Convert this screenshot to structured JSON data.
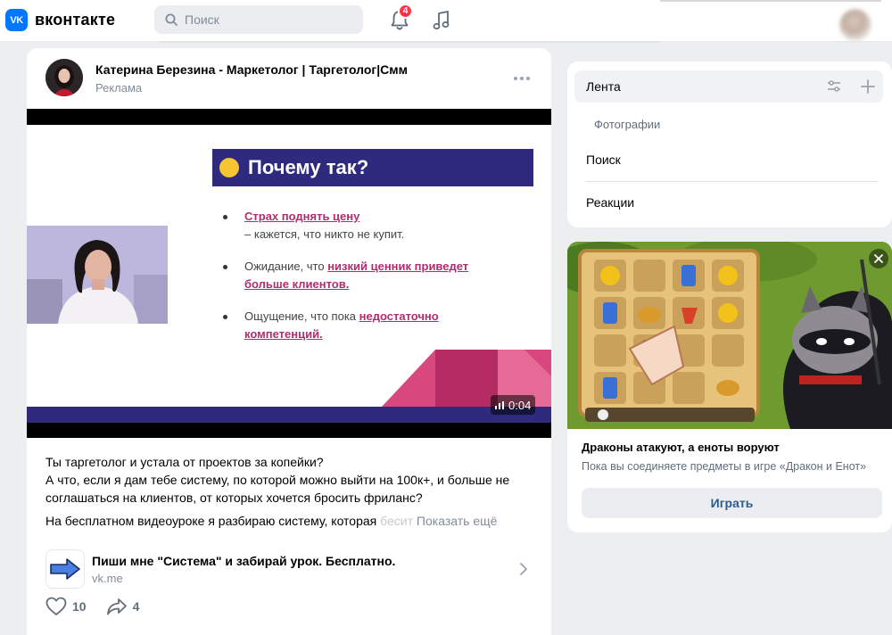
{
  "header": {
    "logo_mark": "VK",
    "logo_text": "вконтакте",
    "search_placeholder": "Поиск",
    "notifications_count": "4"
  },
  "post": {
    "author": "Катерина Березина - Маркетолог | Таргетолог|Смм",
    "subtitle": "Реклама",
    "video": {
      "slide_title": "Почему так?",
      "bullet1_highlight": "Страх поднять цену",
      "bullet1_rest": "– кажется, что никто не купит.",
      "bullet2_text": "Ожидание, что ",
      "bullet2_highlight": "низкий ценник приведет больше клиентов.",
      "bullet3_text": "Ощущение, что пока ",
      "bullet3_highlight": "недостаточно компетенций.",
      "duration": "0:04"
    },
    "text_p1_line1": "Ты таргетолог и устала от проектов за копейки?",
    "text_p1_line2": "А что, если я дам тебе систему, по которой можно выйти на 100к+, и больше не соглашаться на клиентов, от которых хочется бросить фриланс?",
    "text_p2": "На бесплатном видеоуроке я разбираю систему, которая бесит",
    "text_p2_fade": " бесит",
    "show_more": "Показать ещё",
    "link_title": "Пиши мне \"Система\" и забирай урок. Бесплатно.",
    "link_domain": "vk.me",
    "likes": "10",
    "shares": "4"
  },
  "menu": {
    "items": [
      {
        "label": "Лента"
      },
      {
        "label": "Фотографии"
      },
      {
        "label": "Поиск"
      },
      {
        "label": "Реакции"
      }
    ]
  },
  "ad": {
    "title": "Драконы атакуют, а еноты воруют",
    "description": "Пока вы соединяете предметы в игре «Дракон и Енот»",
    "button_label": "Играть"
  },
  "colors": {
    "accent": "#0077ff",
    "badge": "#ff3347",
    "slide_title_bg": "#2e2a7e",
    "highlight": "#b02e6e"
  }
}
